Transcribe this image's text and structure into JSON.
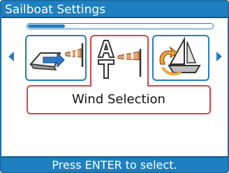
{
  "window": {
    "title": "Sailboat Settings"
  },
  "carousel": {
    "progress": 0.2,
    "items": [
      {
        "icon": "boat-windsock-icon"
      },
      {
        "icon": "auto-true-wind-icon",
        "selected": true
      },
      {
        "icon": "boat-rotate-icon"
      }
    ],
    "selected_label": "Wind Selection"
  },
  "status": {
    "hint": "Press ENTER to select."
  },
  "colors": {
    "accent": "#1f80c0",
    "selection": "#d9434b"
  }
}
